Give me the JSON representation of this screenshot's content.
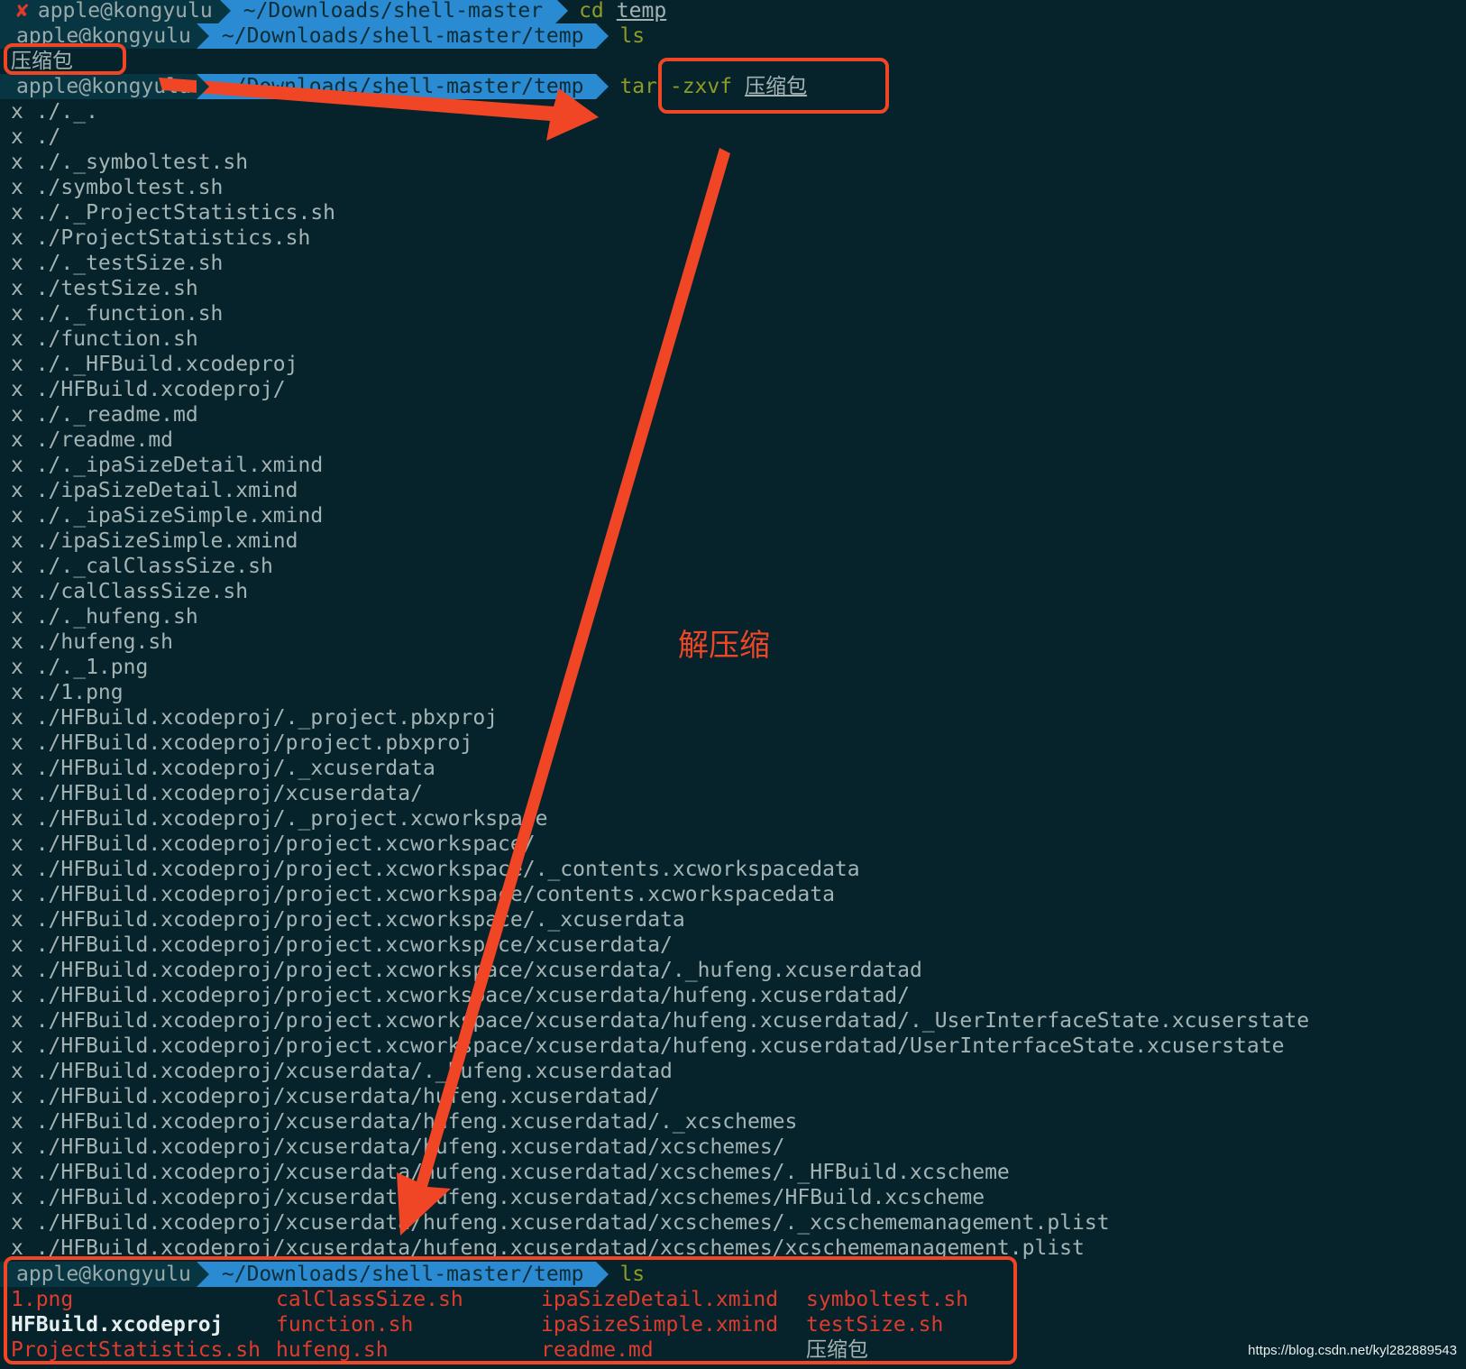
{
  "prompts": [
    {
      "user": "apple@kongyulu",
      "path": "~/Downloads/shell-master",
      "cmd": "cd",
      "arg": "temp",
      "error": "✘"
    },
    {
      "user": "apple@kongyulu",
      "path": "~/Downloads/shell-master/temp",
      "cmd": "ls",
      "arg": ""
    },
    {
      "user": "apple@kongyulu",
      "path": "~/Downloads/shell-master/temp",
      "cmd": "tar -zxvf",
      "arg": "压缩包"
    },
    {
      "user": "apple@kongyulu",
      "path": "~/Downloads/shell-master/temp",
      "cmd": "ls",
      "arg": ""
    }
  ],
  "first_ls_output": "压缩包",
  "extract_lines": [
    "x ./._.",
    "x ./",
    "x ./._symboltest.sh",
    "x ./symboltest.sh",
    "x ./._ProjectStatistics.sh",
    "x ./ProjectStatistics.sh",
    "x ./._testSize.sh",
    "x ./testSize.sh",
    "x ./._function.sh",
    "x ./function.sh",
    "x ./._HFBuild.xcodeproj",
    "x ./HFBuild.xcodeproj/",
    "x ./._readme.md",
    "x ./readme.md",
    "x ./._ipaSizeDetail.xmind",
    "x ./ipaSizeDetail.xmind",
    "x ./._ipaSizeSimple.xmind",
    "x ./ipaSizeSimple.xmind",
    "x ./._calClassSize.sh",
    "x ./calClassSize.sh",
    "x ./._hufeng.sh",
    "x ./hufeng.sh",
    "x ./._1.png",
    "x ./1.png",
    "x ./HFBuild.xcodeproj/._project.pbxproj",
    "x ./HFBuild.xcodeproj/project.pbxproj",
    "x ./HFBuild.xcodeproj/._xcuserdata",
    "x ./HFBuild.xcodeproj/xcuserdata/",
    "x ./HFBuild.xcodeproj/._project.xcworkspace",
    "x ./HFBuild.xcodeproj/project.xcworkspace/",
    "x ./HFBuild.xcodeproj/project.xcworkspace/._contents.xcworkspacedata",
    "x ./HFBuild.xcodeproj/project.xcworkspace/contents.xcworkspacedata",
    "x ./HFBuild.xcodeproj/project.xcworkspace/._xcuserdata",
    "x ./HFBuild.xcodeproj/project.xcworkspace/xcuserdata/",
    "x ./HFBuild.xcodeproj/project.xcworkspace/xcuserdata/._hufeng.xcuserdatad",
    "x ./HFBuild.xcodeproj/project.xcworkspace/xcuserdata/hufeng.xcuserdatad/",
    "x ./HFBuild.xcodeproj/project.xcworkspace/xcuserdata/hufeng.xcuserdatad/._UserInterfaceState.xcuserstate",
    "x ./HFBuild.xcodeproj/project.xcworkspace/xcuserdata/hufeng.xcuserdatad/UserInterfaceState.xcuserstate",
    "x ./HFBuild.xcodeproj/xcuserdata/._hufeng.xcuserdatad",
    "x ./HFBuild.xcodeproj/xcuserdata/hufeng.xcuserdatad/",
    "x ./HFBuild.xcodeproj/xcuserdata/hufeng.xcuserdatad/._xcschemes",
    "x ./HFBuild.xcodeproj/xcuserdata/hufeng.xcuserdatad/xcschemes/",
    "x ./HFBuild.xcodeproj/xcuserdata/hufeng.xcuserdatad/xcschemes/._HFBuild.xcscheme",
    "x ./HFBuild.xcodeproj/xcuserdata/hufeng.xcuserdatad/xcschemes/HFBuild.xcscheme",
    "x ./HFBuild.xcodeproj/xcuserdata/hufeng.xcuserdatad/xcschemes/._xcschememanagement.plist",
    "x ./HFBuild.xcodeproj/xcuserdata/hufeng.xcuserdatad/xcschemes/xcschememanagement.plist"
  ],
  "final_ls": [
    {
      "name": "1.png",
      "kind": "file"
    },
    {
      "name": "calClassSize.sh",
      "kind": "file"
    },
    {
      "name": "ipaSizeDetail.xmind",
      "kind": "file"
    },
    {
      "name": "symboltest.sh",
      "kind": "file"
    },
    {
      "name": "HFBuild.xcodeproj",
      "kind": "dir"
    },
    {
      "name": "function.sh",
      "kind": "file"
    },
    {
      "name": "ipaSizeSimple.xmind",
      "kind": "file"
    },
    {
      "name": "testSize.sh",
      "kind": "file"
    },
    {
      "name": "ProjectStatistics.sh",
      "kind": "file"
    },
    {
      "name": "hufeng.sh",
      "kind": "file"
    },
    {
      "name": "readme.md",
      "kind": "file"
    },
    {
      "name": "压缩包",
      "kind": "plain"
    }
  ],
  "annotation": {
    "label": "解压缩",
    "color": "#f04626",
    "arrow_icon": "arrow-icon"
  },
  "watermark": "https://blog.csdn.net/kyl282889543",
  "colors": {
    "background": "#06232c",
    "path_segment": "#2a8bd2",
    "user_segment": "#083542",
    "command": "#8f9c23",
    "file": "#e03b2c"
  }
}
